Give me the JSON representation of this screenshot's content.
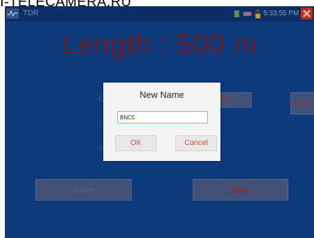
{
  "watermark": "I-TELECAMERA.RU",
  "app": {
    "title": "TDR"
  },
  "status": {
    "time": "5:33:55 PM"
  },
  "main": {
    "length_label": "Length",
    "length_value": "500",
    "length_unit": "m",
    "partial_name_button": "ed1",
    "back_button": "Back",
    "start_button": "Start",
    "save_button": "Save"
  },
  "dialog": {
    "title": "New Name",
    "input_value": "BNC5",
    "ok_label": "OK",
    "cancel_label": "Cancel"
  },
  "colors": {
    "screen_bg": "#103a7e",
    "length_text": "#6a1d25",
    "dialog_accent": "#d05a3e",
    "input_border": "#e3a252",
    "close_button": "#b53322"
  },
  "icons": [
    "app-waveform-icon",
    "battery-icon",
    "usb-icon",
    "sd-card-icon",
    "close-icon"
  ]
}
